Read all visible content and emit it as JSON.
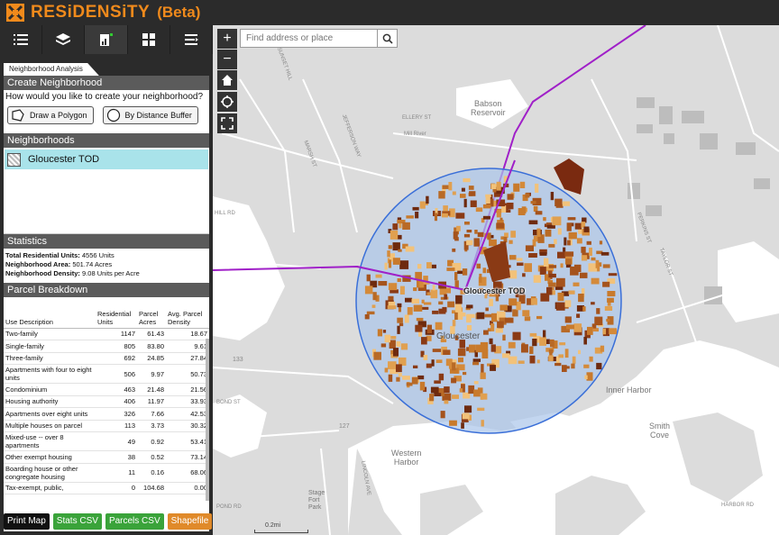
{
  "app": {
    "title": "RESiDENSiTY",
    "beta": "(Beta)"
  },
  "toolbar": {
    "icons": [
      "list-icon",
      "layers-icon",
      "analysis-icon",
      "grid-icon",
      "menu-icon"
    ]
  },
  "tabs": {
    "active": "Neighborhood Analysis"
  },
  "create": {
    "heading": "Create Neighborhood",
    "question": "How would you like to create your neighborhood?",
    "polygon_label": "Draw a Polygon",
    "buffer_label": "By Distance Buffer"
  },
  "neighborhoods": {
    "heading": "Neighborhoods",
    "items": [
      {
        "name": "Gloucester TOD"
      }
    ]
  },
  "statistics": {
    "heading": "Statistics",
    "units_label": "Total Residential Units:",
    "units_value": "4556 Units",
    "area_label": "Neighborhood Area:",
    "area_value": "501.74 Acres",
    "density_label": "Neighborhood Density:",
    "density_value": "9.08 Units per Acre"
  },
  "parcel": {
    "heading": "Parcel Breakdown",
    "columns": [
      "Use Description",
      "Residential Units",
      "Parcel Acres",
      "Avg. Parcel Density"
    ],
    "rows": [
      [
        "Two-family",
        "1147",
        "61.43",
        "18.67"
      ],
      [
        "Single-family",
        "805",
        "83.80",
        "9.61"
      ],
      [
        "Three-family",
        "692",
        "24.85",
        "27.84"
      ],
      [
        "Apartments with four to eight units",
        "506",
        "9.97",
        "50.73"
      ],
      [
        "Condominium",
        "463",
        "21.48",
        "21.56"
      ],
      [
        "Housing authority",
        "406",
        "11.97",
        "33.93"
      ],
      [
        "Apartments over eight units",
        "326",
        "7.66",
        "42.53"
      ],
      [
        "Multiple houses on parcel",
        "113",
        "3.73",
        "30.32"
      ],
      [
        "Mixed-use -- over 8 apartments",
        "49",
        "0.92",
        "53.41"
      ],
      [
        "Other exempt housing",
        "38",
        "0.52",
        "73.14"
      ],
      [
        "Boarding house or other congregate housing",
        "11",
        "0.16",
        "68.06"
      ],
      [
        "Tax-exempt, public,",
        "0",
        "104.68",
        "0.00"
      ]
    ]
  },
  "buttons": {
    "print": "Print Map",
    "stats_csv": "Stats CSV",
    "parcels_csv": "Parcels CSV",
    "shapefile": "Shapefile"
  },
  "map": {
    "search_placeholder": "Find address or place",
    "zoom_in": "+",
    "zoom_out": "−",
    "tod_label": "Gloucester TOD",
    "city_label": "Gloucester",
    "scale_label": "0.2mi",
    "places": {
      "babson": "Babson\nReservoir",
      "inner_harbor": "Inner Harbor",
      "western_harbor": "Western\nHarbor",
      "smith_cove": "Smith\nCove",
      "stage_fort": "Stage\nFort\nPark"
    },
    "roads": [
      "SUNSET HILL",
      "ELLERY ST",
      "Mill River",
      "MARSH ST",
      "JEFFERSON WAY",
      "HILL RD",
      "TAYLOR ST",
      "PERKINS ST",
      "BOND ST",
      "LINCOLN AVE",
      "POND RD",
      "HARBOR RD",
      "133",
      "127"
    ],
    "colors": {
      "buffer_fill": "#a9c4ea",
      "buffer_stroke": "#3a6fd8",
      "rail": "#a020c8",
      "water": "#ffffff",
      "land": "#dcdcdc"
    }
  }
}
